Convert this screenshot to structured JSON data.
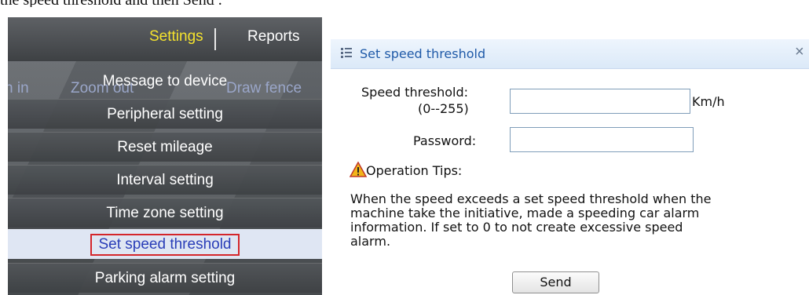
{
  "caption": "the speed threshold and then  Send .",
  "menu": {
    "tabs": [
      {
        "label": "Settings",
        "active": true
      },
      {
        "label": "Reports",
        "active": false
      }
    ],
    "toolbar_ghost": {
      "zoom_in": "n in",
      "zoom_out": "Zoom out",
      "draw_fence": "Draw fence"
    },
    "items": [
      {
        "label": "Message to device"
      },
      {
        "label": "Peripheral setting"
      },
      {
        "label": "Reset mileage"
      },
      {
        "label": "Interval setting"
      },
      {
        "label": "Time zone setting"
      },
      {
        "label": "Set speed threshold",
        "selected": true
      },
      {
        "label": "Parking alarm setting"
      }
    ],
    "colors": {
      "active_tab": "#f5e32d",
      "highlight_border": "#d4262b",
      "selected_text": "#2a3eb8"
    }
  },
  "dialog": {
    "title": "Set speed threshold",
    "title_icon": "list-icon",
    "close_glyph": "×",
    "speed_label_line1": "Speed threshold:",
    "speed_label_line2": "(0--255)",
    "speed_value": "",
    "speed_unit": "Km/h",
    "password_label": "Password:",
    "password_value": "",
    "tips_icon": "warning-icon",
    "tips_title": "Operation Tips:",
    "tips_text": "When the speed exceeds a set speed threshold when the machine take the initiative, made a speeding car alarm information. If set to 0 to not create excessive speed alarm.",
    "send_label": "Send"
  }
}
